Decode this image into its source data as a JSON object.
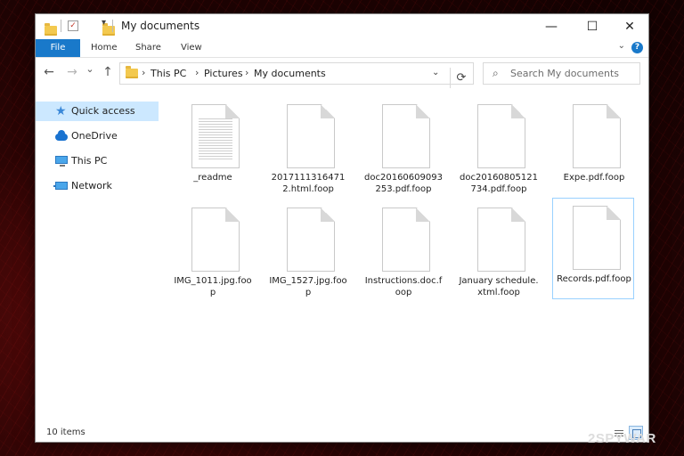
{
  "window": {
    "title": "My documents",
    "controls": {
      "minimize": "—",
      "maximize": "☐",
      "close": "✕"
    }
  },
  "ribbon": {
    "tabs": [
      "File",
      "Home",
      "Share",
      "View"
    ]
  },
  "nav": {
    "back": "←",
    "forward": "→",
    "recent": "⌄",
    "up": "↑",
    "breadcrumb": [
      "This PC",
      "Pictures",
      "My documents"
    ],
    "refresh": "⟳"
  },
  "search": {
    "placeholder": "Search My documents"
  },
  "sidebar": {
    "items": [
      {
        "label": "Quick access",
        "icon": "star-icon",
        "active": true
      },
      {
        "label": "OneDrive",
        "icon": "cloud-icon",
        "active": false
      },
      {
        "label": "This PC",
        "icon": "computer-icon",
        "active": false
      },
      {
        "label": "Network",
        "icon": "network-icon",
        "active": false
      }
    ]
  },
  "files": [
    {
      "name": "_readme",
      "icon": "text-document-icon"
    },
    {
      "name": "20171113164712.html.foop",
      "icon": "document-icon"
    },
    {
      "name": "doc20160609093253.pdf.foop",
      "icon": "document-icon"
    },
    {
      "name": "doc20160805121734.pdf.foop",
      "icon": "document-icon"
    },
    {
      "name": "Expe.pdf.foop",
      "icon": "document-icon"
    },
    {
      "name": "IMG_1011.jpg.foop",
      "icon": "document-icon"
    },
    {
      "name": "IMG_1527.jpg.foop",
      "icon": "document-icon"
    },
    {
      "name": "Instructions.doc.foop",
      "icon": "document-icon"
    },
    {
      "name": "January schedule.xtml.foop",
      "icon": "document-icon"
    },
    {
      "name": "Records.pdf.foop",
      "icon": "document-icon",
      "selected": true
    }
  ],
  "status": {
    "item_count": "10 items"
  },
  "watermark": "2SPYWAR",
  "colors": {
    "accent": "#1979ca",
    "selection": "#cce8ff",
    "folder": "#f3c94f"
  }
}
